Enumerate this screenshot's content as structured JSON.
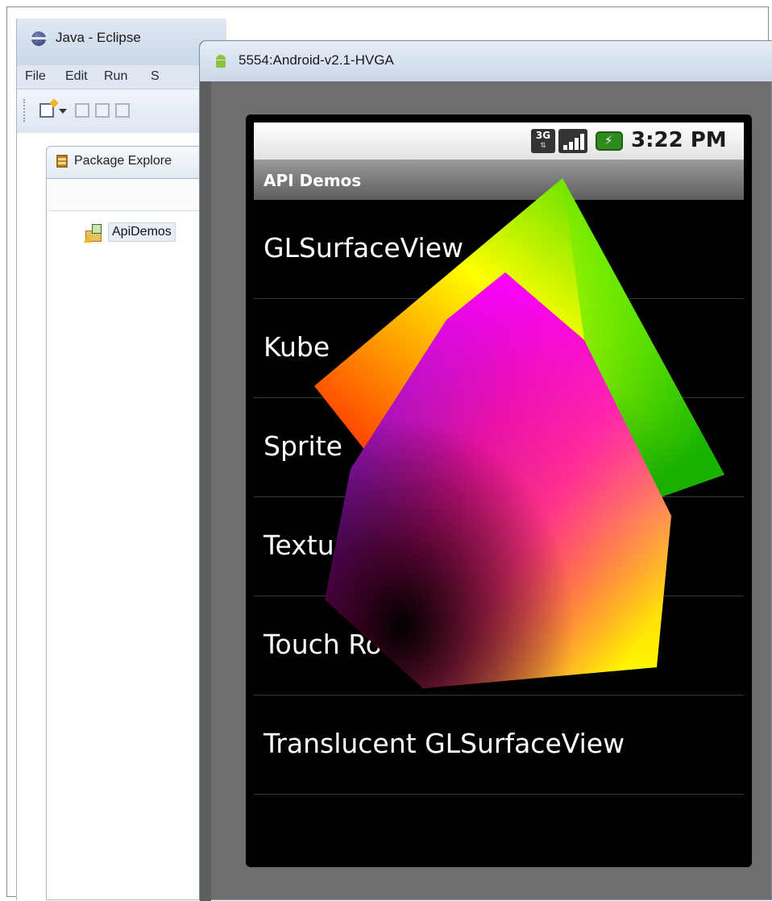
{
  "eclipse": {
    "title": "Java - Eclipse",
    "menu": [
      "File",
      "Edit",
      "Run",
      "S"
    ],
    "package_explorer_tab": "Package Explore",
    "project": "ApiDemos"
  },
  "emulator": {
    "title": "5554:Android-v2.1-HVGA",
    "status_bar": {
      "network": "3G",
      "time": "3:22 PM"
    },
    "app_title": "API Demos",
    "list_items": [
      "GLSurfaceView",
      "Kube",
      "Sprite",
      "Textu",
      "Touch Ro",
      "Translucent GLSurfaceView"
    ]
  },
  "colors": {
    "screen_bg": "#000000",
    "emulator_frame": "#6e6e6e",
    "title_bar": "#cbd8e8"
  }
}
